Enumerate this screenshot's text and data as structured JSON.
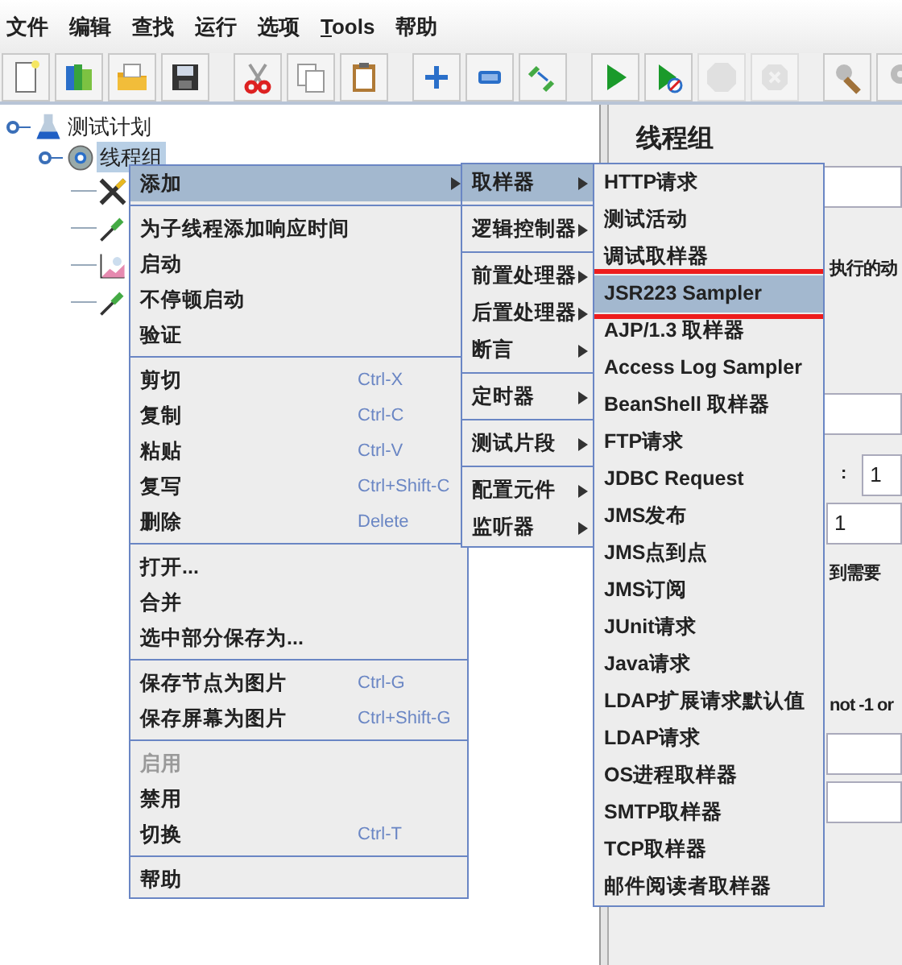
{
  "menubar": [
    {
      "label": "文件",
      "mnemonic": false
    },
    {
      "label": "编辑",
      "mnemonic": false
    },
    {
      "label": "查找",
      "mnemonic": false
    },
    {
      "label": "运行",
      "mnemonic": false
    },
    {
      "label": "选项",
      "mnemonic": false
    },
    {
      "label": "Tools",
      "mnemonic": true
    },
    {
      "label": "帮助",
      "mnemonic": false
    }
  ],
  "toolbar": [
    [
      {
        "kind": "new",
        "disabled": false
      },
      {
        "kind": "templates",
        "disabled": false
      },
      {
        "kind": "open",
        "disabled": false
      },
      {
        "kind": "save",
        "disabled": false
      }
    ],
    [
      {
        "kind": "cut",
        "disabled": false
      },
      {
        "kind": "copy",
        "disabled": false
      },
      {
        "kind": "paste",
        "disabled": false
      }
    ],
    [
      {
        "kind": "expand",
        "disabled": false
      },
      {
        "kind": "collapse",
        "disabled": false
      },
      {
        "kind": "toggle",
        "disabled": false
      }
    ],
    [
      {
        "kind": "start",
        "disabled": false
      },
      {
        "kind": "start_no_pause",
        "disabled": false
      },
      {
        "kind": "stop",
        "disabled": true
      },
      {
        "kind": "shutdown",
        "disabled": true
      }
    ],
    [
      {
        "kind": "clear",
        "disabled": false
      },
      {
        "kind": "clear_all",
        "disabled": false
      }
    ]
  ],
  "tree": {
    "label": "测试计划",
    "kind": "plan",
    "selected": false,
    "children": [
      {
        "label": "线程组",
        "kind": "thread_group",
        "selected": true,
        "children": [
          {
            "kind": "tools"
          },
          {
            "kind": "pipette"
          },
          {
            "kind": "graph"
          },
          {
            "kind": "pipette"
          }
        ]
      }
    ]
  },
  "panel": {
    "title": "线程组",
    "texts": [
      {
        "kind": "field"
      },
      {
        "kind": "text",
        "text": "执行的动"
      },
      {
        "kind": "field"
      },
      {
        "kind": "labeled_field",
        "text": ":",
        "value": "1"
      },
      {
        "kind": "field",
        "value": "1"
      },
      {
        "kind": "text",
        "text": "到需要"
      },
      {
        "kind": "text",
        "text": "not -1 or"
      },
      {
        "kind": "field"
      },
      {
        "kind": "field"
      }
    ]
  },
  "context_menu": [
    {
      "kind": "item",
      "label": "添加",
      "submenu": true,
      "selected": true,
      "disabled": false
    },
    {
      "kind": "separator"
    },
    {
      "kind": "item",
      "label": "为子线程添加响应时间",
      "submenu": false,
      "selected": false,
      "disabled": false
    },
    {
      "kind": "item",
      "label": "启动",
      "submenu": false,
      "selected": false,
      "disabled": false
    },
    {
      "kind": "item",
      "label": "不停顿启动",
      "submenu": false,
      "selected": false,
      "disabled": false
    },
    {
      "kind": "item",
      "label": "验证",
      "submenu": false,
      "selected": false,
      "disabled": false
    },
    {
      "kind": "separator"
    },
    {
      "kind": "item",
      "label": "剪切",
      "shortcut": "Ctrl-X",
      "submenu": false,
      "selected": false,
      "disabled": false
    },
    {
      "kind": "item",
      "label": "复制",
      "shortcut": "Ctrl-C",
      "submenu": false,
      "selected": false,
      "disabled": false
    },
    {
      "kind": "item",
      "label": "粘贴",
      "shortcut": "Ctrl-V",
      "submenu": false,
      "selected": false,
      "disabled": false
    },
    {
      "kind": "item",
      "label": "复写",
      "shortcut": "Ctrl+Shift-C",
      "submenu": false,
      "selected": false,
      "disabled": false
    },
    {
      "kind": "item",
      "label": "删除",
      "shortcut": "Delete",
      "submenu": false,
      "selected": false,
      "disabled": false
    },
    {
      "kind": "separator"
    },
    {
      "kind": "item",
      "label": "打开...",
      "submenu": false,
      "selected": false,
      "disabled": false
    },
    {
      "kind": "item",
      "label": "合并",
      "submenu": false,
      "selected": false,
      "disabled": false
    },
    {
      "kind": "item",
      "label": "选中部分保存为...",
      "submenu": false,
      "selected": false,
      "disabled": false
    },
    {
      "kind": "separator"
    },
    {
      "kind": "item",
      "label": "保存节点为图片",
      "shortcut": "Ctrl-G",
      "submenu": false,
      "selected": false,
      "disabled": false
    },
    {
      "kind": "item",
      "label": "保存屏幕为图片",
      "shortcut": "Ctrl+Shift-G",
      "submenu": false,
      "selected": false,
      "disabled": false
    },
    {
      "kind": "separator"
    },
    {
      "kind": "item",
      "label": "启用",
      "submenu": false,
      "selected": false,
      "disabled": true
    },
    {
      "kind": "item",
      "label": "禁用",
      "submenu": false,
      "selected": false,
      "disabled": false
    },
    {
      "kind": "item",
      "label": "切换",
      "shortcut": "Ctrl-T",
      "submenu": false,
      "selected": false,
      "disabled": false
    },
    {
      "kind": "separator"
    },
    {
      "kind": "item",
      "label": "帮助",
      "submenu": false,
      "selected": false,
      "disabled": false
    }
  ],
  "add_submenu": [
    {
      "kind": "item",
      "label": "取样器",
      "submenu": true,
      "selected": true
    },
    {
      "kind": "separator"
    },
    {
      "kind": "item",
      "label": "逻辑控制器",
      "submenu": true,
      "selected": false
    },
    {
      "kind": "separator"
    },
    {
      "kind": "item",
      "label": "前置处理器",
      "submenu": true,
      "selected": false
    },
    {
      "kind": "item",
      "label": "后置处理器",
      "submenu": true,
      "selected": false
    },
    {
      "kind": "item",
      "label": "断言",
      "submenu": true,
      "selected": false
    },
    {
      "kind": "separator"
    },
    {
      "kind": "item",
      "label": "定时器",
      "submenu": true,
      "selected": false
    },
    {
      "kind": "separator"
    },
    {
      "kind": "item",
      "label": "测试片段",
      "submenu": true,
      "selected": false
    },
    {
      "kind": "separator"
    },
    {
      "kind": "item",
      "label": "配置元件",
      "submenu": true,
      "selected": false
    },
    {
      "kind": "item",
      "label": "监听器",
      "submenu": true,
      "selected": false
    }
  ],
  "sampler_submenu": [
    {
      "kind": "item",
      "label": "HTTP请求",
      "selected": false,
      "annotated": false
    },
    {
      "kind": "item",
      "label": "测试活动",
      "selected": false,
      "annotated": false
    },
    {
      "kind": "item",
      "label": "调试取样器",
      "selected": false,
      "annotated": false
    },
    {
      "kind": "item",
      "label": "JSR223 Sampler",
      "selected": true,
      "annotated": true
    },
    {
      "kind": "item",
      "label": "AJP/1.3 取样器",
      "selected": false,
      "annotated": false
    },
    {
      "kind": "item",
      "label": "Access Log Sampler",
      "selected": false,
      "annotated": false
    },
    {
      "kind": "item",
      "label": "BeanShell 取样器",
      "selected": false,
      "annotated": false
    },
    {
      "kind": "item",
      "label": "FTP请求",
      "selected": false,
      "annotated": false
    },
    {
      "kind": "item",
      "label": "JDBC Request",
      "selected": false,
      "annotated": false
    },
    {
      "kind": "item",
      "label": "JMS发布",
      "selected": false,
      "annotated": false
    },
    {
      "kind": "item",
      "label": "JMS点到点",
      "selected": false,
      "annotated": false
    },
    {
      "kind": "item",
      "label": "JMS订阅",
      "selected": false,
      "annotated": false
    },
    {
      "kind": "item",
      "label": "JUnit请求",
      "selected": false,
      "annotated": false
    },
    {
      "kind": "item",
      "label": "Java请求",
      "selected": false,
      "annotated": false
    },
    {
      "kind": "item",
      "label": "LDAP扩展请求默认值",
      "selected": false,
      "annotated": false
    },
    {
      "kind": "item",
      "label": "LDAP请求",
      "selected": false,
      "annotated": false
    },
    {
      "kind": "item",
      "label": "OS进程取样器",
      "selected": false,
      "annotated": false
    },
    {
      "kind": "item",
      "label": "SMTP取样器",
      "selected": false,
      "annotated": false
    },
    {
      "kind": "item",
      "label": "TCP取样器",
      "selected": false,
      "annotated": false
    },
    {
      "kind": "item",
      "label": "邮件阅读者取样器",
      "selected": false,
      "annotated": false
    }
  ]
}
